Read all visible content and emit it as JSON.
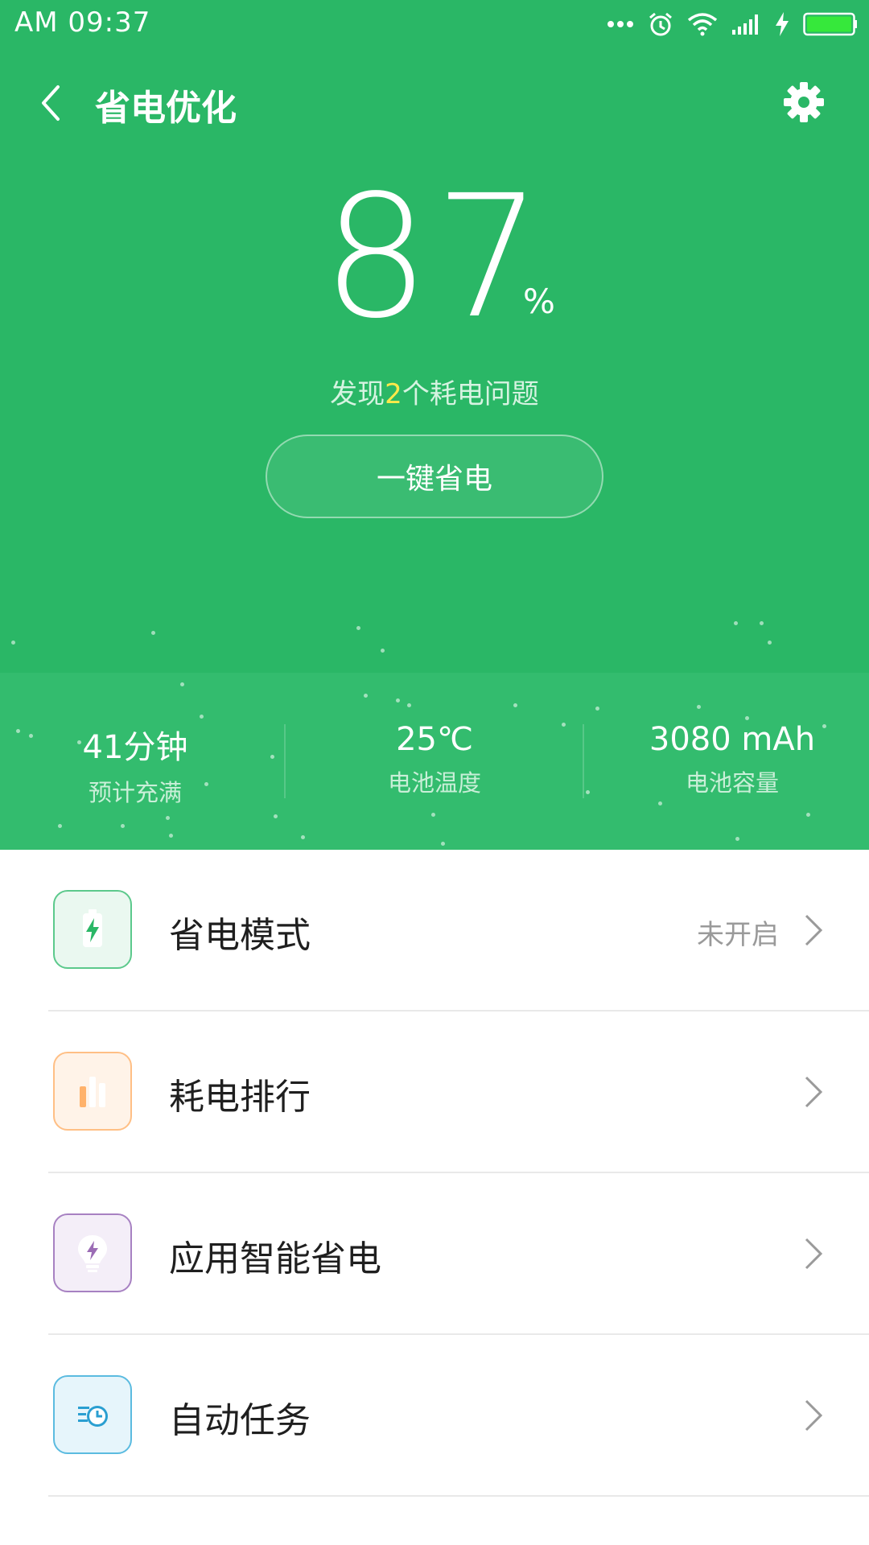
{
  "status_bar": {
    "time": "AM  09:37",
    "icons": [
      "dots-icon",
      "alarm-icon",
      "wifi-icon",
      "signal-icon",
      "charging-icon",
      "battery-icon"
    ],
    "battery_color": "#36e83b"
  },
  "header": {
    "title": "省电优化",
    "back_icon": "back-arrow-icon",
    "settings_icon": "gear-icon"
  },
  "battery": {
    "percent": "87",
    "unit": "%",
    "issue_prefix": "发现",
    "issue_count": "2",
    "issue_suffix": "个耗电问题",
    "optimize_button": "一键省电"
  },
  "stats": [
    {
      "value": "41分钟",
      "label": "预计充满"
    },
    {
      "value": "25℃",
      "label": "电池温度"
    },
    {
      "value": "3080 mAh",
      "label": "电池容量"
    }
  ],
  "menu": [
    {
      "label": "省电模式",
      "status": "未开启",
      "icon": "battery-bolt-icon",
      "color": "#2ab766"
    },
    {
      "label": "耗电排行",
      "status": "",
      "icon": "bar-chart-icon",
      "color": "#ff9a3c"
    },
    {
      "label": "应用智能省电",
      "status": "",
      "icon": "lightbulb-bolt-icon",
      "color": "#9b6cb5"
    },
    {
      "label": "自动任务",
      "status": "",
      "icon": "clock-task-icon",
      "color": "#2a9fd1"
    }
  ],
  "colors": {
    "header_green": "#2ab766",
    "band_green": "#33bc6e",
    "highlight_yellow": "#ffe94a"
  }
}
